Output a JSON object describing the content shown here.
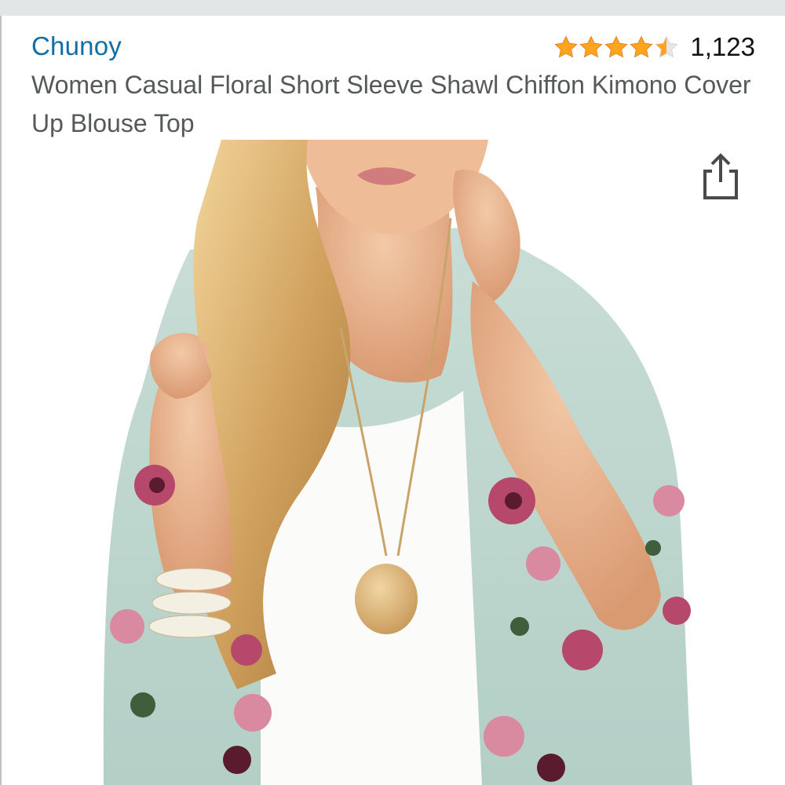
{
  "product": {
    "brand": "Chunoy",
    "title": "Women Casual Floral Short Sleeve Shawl Chiffon Kimono Cover Up Blouse Top",
    "rating": 4.5,
    "review_count": "1,123"
  },
  "image": {
    "icon": "product-photo"
  },
  "actions": {
    "share_icon": "share-icon"
  },
  "colors": {
    "brand_link": "#0f6da8",
    "star": "#ffa41c",
    "star_empty": "#e0e0e0",
    "title": "#565959"
  }
}
